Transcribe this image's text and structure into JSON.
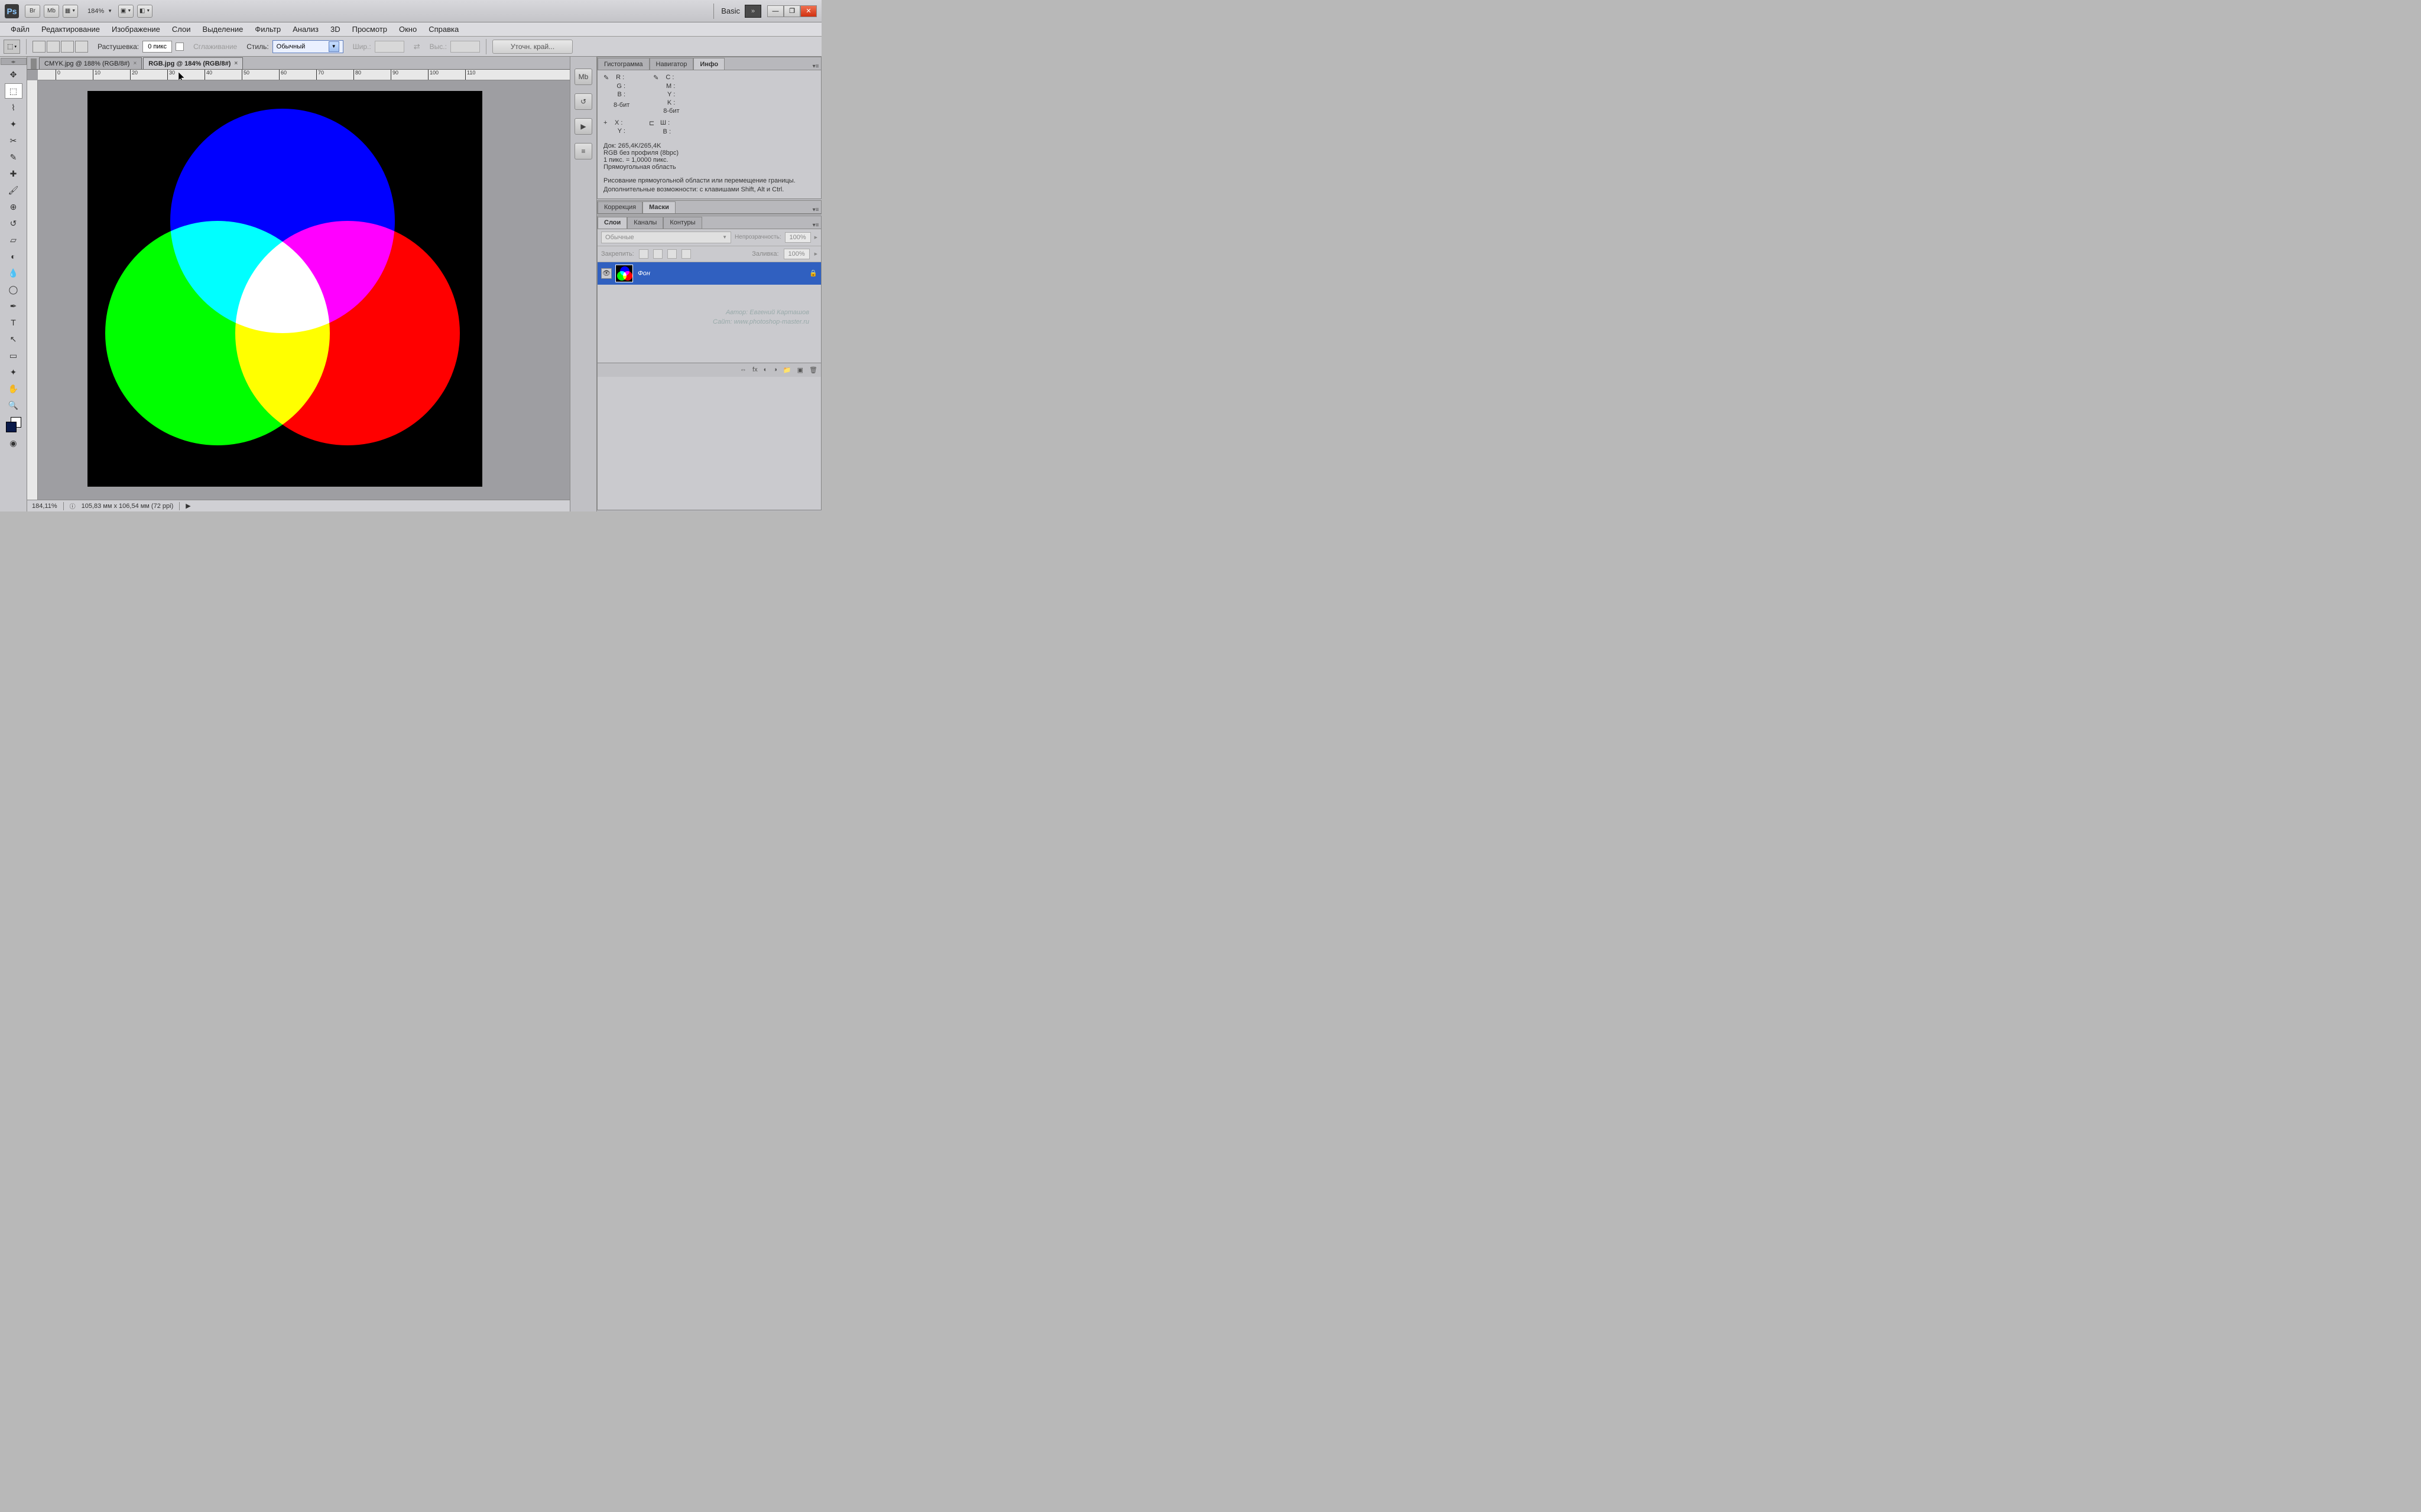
{
  "titlebar": {
    "zoom": "184%",
    "workspace": "Basic"
  },
  "menu": {
    "file": "Файл",
    "edit": "Редактирование",
    "image": "Изображение",
    "layers": "Слои",
    "select": "Выделение",
    "filter": "Фильтр",
    "analysis": "Анализ",
    "threed": "3D",
    "view": "Просмотр",
    "window": "Окно",
    "help": "Справка"
  },
  "options": {
    "feather_label": "Растушевка:",
    "feather_value": "0 пикс",
    "antialias": "Сглаживание",
    "style_label": "Стиль:",
    "style_value": "Обычный",
    "width_label": "Шир.:",
    "height_label": "Выс.:",
    "refine": "Уточн. край..."
  },
  "tabs": {
    "t1": "CMYK.jpg @ 188% (RGB/8#)",
    "t2": "RGB.jpg @ 184% (RGB/8#)"
  },
  "ruler": {
    "marks": [
      "0",
      "10",
      "20",
      "30",
      "40",
      "50",
      "60",
      "70",
      "80",
      "90",
      "100",
      "110"
    ]
  },
  "status": {
    "zoom": "184,11%",
    "docinfo": "105,83 мм x 106,54 мм (72 ppi)"
  },
  "info_panel": {
    "tabs": {
      "hist": "Гистограмма",
      "nav": "Навигатор",
      "info": "Инфо"
    },
    "r": "R :",
    "g": "G :",
    "b": "B :",
    "c": "C :",
    "m": "M :",
    "y": "Y :",
    "k": "K :",
    "bit1": "8-бит",
    "bit2": "8-бит",
    "x": "X :",
    "yy": "Y :",
    "w": "Ш :",
    "h": "В :",
    "doc": "Док: 265,4K/265,4K",
    "profile": "RGB без профиля (8bpc)",
    "px": "1 пикс. = 1,0000 пикс.",
    "shape": "Прямоугольная область",
    "desc1": "Рисование прямоугольной области или перемещение границы.",
    "desc2": "Дополнительные возможности: с клавишами Shift, Alt и Ctrl."
  },
  "adjust_panel": {
    "corr": "Коррекция",
    "masks": "Маски"
  },
  "layers_panel": {
    "tabs": {
      "layers": "Слои",
      "channels": "Каналы",
      "paths": "Контуры"
    },
    "mode": "Обычные",
    "opacity_label": "Непрозрачность:",
    "opacity_value": "100%",
    "lock_label": "Закрепить:",
    "fill_label": "Заливка:",
    "fill_value": "100%",
    "layer_name": "Фон"
  },
  "watermark": {
    "l1": "Автор: Евгений Карташов",
    "l2": "Сайт: www.photoshop-master.ru"
  }
}
